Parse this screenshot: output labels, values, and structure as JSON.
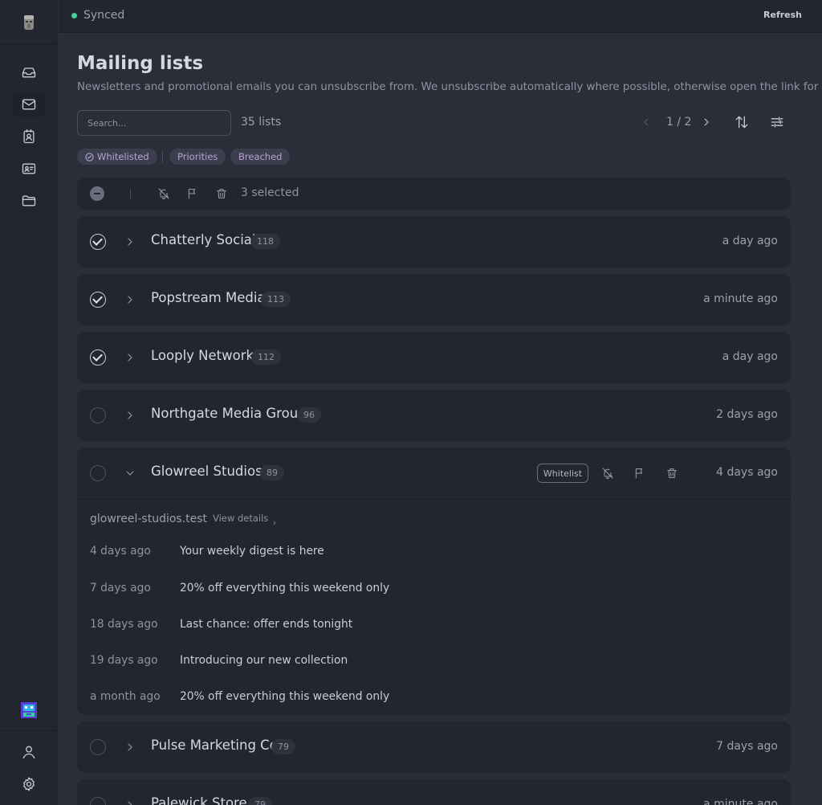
{
  "status": {
    "text": "Synced",
    "color": "#3fd0a0"
  },
  "topbar": {
    "refresh_label": "Refresh"
  },
  "page": {
    "title": "Mailing lists",
    "subtitle": "Newsletters and promotional emails you can unsubscribe from. We unsubscribe automatically where possible, otherwise open the link for you."
  },
  "search": {
    "placeholder": "Search...",
    "value": ""
  },
  "count_label": "35 lists",
  "pager": {
    "label": "1 / 2"
  },
  "chips": {
    "whitelisted": "Whitelisted",
    "priorities": "Priorities",
    "breached": "Breached"
  },
  "bulk": {
    "selected_label": "3 selected"
  },
  "rows": [
    {
      "name": "Chatterly Social",
      "count": "118",
      "time": "a day ago",
      "checked": true
    },
    {
      "name": "Popstream Media",
      "count": "113",
      "time": "a minute ago",
      "checked": true
    },
    {
      "name": "Looply Network",
      "count": "112",
      "time": "a day ago",
      "checked": true
    },
    {
      "name": "Northgate Media Group",
      "count": "96",
      "time": "2 days ago",
      "checked": false
    }
  ],
  "expanded": {
    "name": "Glowreel Studios",
    "count": "89",
    "time": "4 days ago",
    "whitelist_label": "Whitelist",
    "domain": "glowreel-studios.test",
    "view_details_label": "View details",
    "messages": [
      {
        "time": "4 days ago",
        "subject": "Your weekly digest is here"
      },
      {
        "time": "7 days ago",
        "subject": "20% off everything this weekend only"
      },
      {
        "time": "18 days ago",
        "subject": "Last chance: offer ends tonight"
      },
      {
        "time": "19 days ago",
        "subject": "Introducing our new collection"
      },
      {
        "time": "a month ago",
        "subject": "20% off everything this weekend only"
      }
    ]
  },
  "rows_after": [
    {
      "name": "Pulse Marketing Co",
      "count": "79",
      "time": "7 days ago",
      "checked": false
    },
    {
      "name": "Palewick Store",
      "count": "79",
      "time": "a minute ago",
      "checked": false
    }
  ],
  "icons": {
    "logo": "moai-icon",
    "nav": [
      "inbox-icon",
      "mail-icon",
      "contact-book-icon",
      "id-card-icon",
      "folder-icon"
    ],
    "bottom": [
      "avatar-icon",
      "user-icon",
      "gear-icon"
    ]
  }
}
